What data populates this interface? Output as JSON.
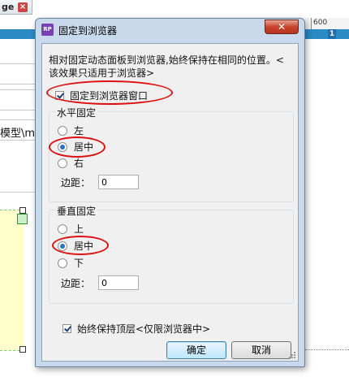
{
  "background": {
    "tab_label": "ge 1",
    "ruler_label": "600",
    "badge_label": "1",
    "field_text": "模型\\me"
  },
  "dialog": {
    "title": "固定到浏览器",
    "icon_label": "RP",
    "close_label": "✕",
    "description": "相对固定动态面板到浏览器,始终保持在相同的位置。< 该效果只适用于浏览器>",
    "pin_to_browser": {
      "label": "固定到浏览器窗口",
      "checked": true
    },
    "horizontal": {
      "legend": "水平固定",
      "options": [
        {
          "label": "左",
          "selected": false
        },
        {
          "label": "居中",
          "selected": true
        },
        {
          "label": "右",
          "selected": false
        }
      ],
      "margin_label": "边距：",
      "margin_value": "0"
    },
    "vertical": {
      "legend": "垂直固定",
      "options": [
        {
          "label": "上",
          "selected": false
        },
        {
          "label": "居中",
          "selected": true
        },
        {
          "label": "下",
          "selected": false
        }
      ],
      "margin_label": "边距：",
      "margin_value": "0"
    },
    "keep_on_top": {
      "label": "始终保持顶层<仅限浏览器中>",
      "checked": true
    },
    "ok_label": "确定",
    "cancel_label": "取消",
    "annotation_color": "#dd1111"
  }
}
